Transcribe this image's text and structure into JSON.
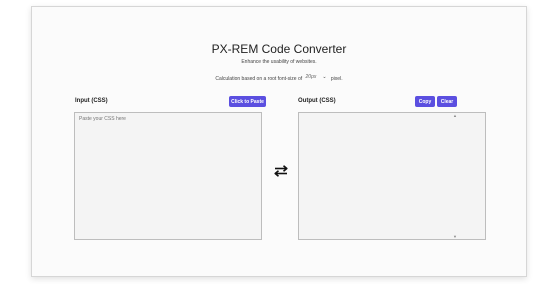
{
  "header": {
    "title": "PX-REM Code Converter",
    "subtitle": "Enhance the usability of websites."
  },
  "calculation": {
    "prefix": "Calculation based on a root font-size of",
    "selected_value": "20px",
    "suffix": "pixel."
  },
  "input_panel": {
    "label": "Input (CSS)",
    "paste_button_label": "Click to Paste",
    "placeholder": "Paste your CSS here",
    "value": ""
  },
  "output_panel": {
    "label": "Output (CSS)",
    "copy_button_label": "Copy",
    "clear_button_label": "Clear",
    "value": ""
  },
  "icons": {
    "swap": "swap-arrows-icon"
  },
  "colors": {
    "accent": "#5b4fe0",
    "card_background": "#fbfbfb",
    "textarea_background": "#f4f4f4"
  }
}
